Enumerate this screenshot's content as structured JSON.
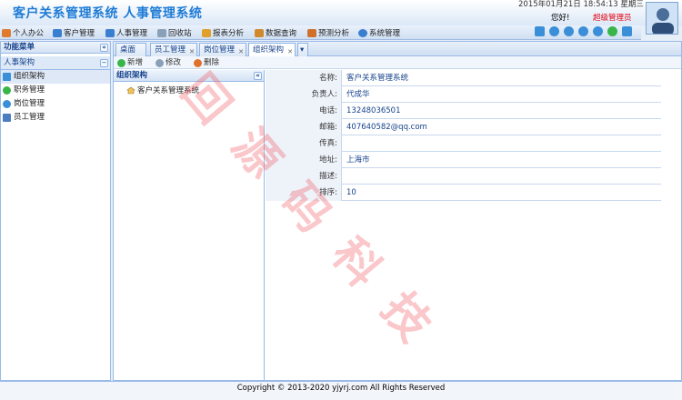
{
  "header": {
    "title": "客户关系管理系统 人事管理系统",
    "datetime": "2015年01月21日 18:54:13 星期三",
    "greeting": "您好!",
    "user": "超级管理员"
  },
  "menu": [
    {
      "label": "个人办公",
      "icon": "home-icon",
      "color": "#e07a2c"
    },
    {
      "label": "客户管理",
      "icon": "link-icon",
      "color": "#3a7ed0"
    },
    {
      "label": "人事管理",
      "icon": "users-icon",
      "color": "#3a7ed0"
    },
    {
      "label": "回收站",
      "icon": "trash-icon",
      "color": "#8aa0b8"
    },
    {
      "label": "报表分析",
      "icon": "report-icon",
      "color": "#e0a02c"
    },
    {
      "label": "数据查询",
      "icon": "search-data-icon",
      "color": "#d08a2c"
    },
    {
      "label": "预测分析",
      "icon": "chart-icon",
      "color": "#d0702c"
    },
    {
      "label": "系统管理",
      "icon": "gear-icon",
      "color": "#3a7ed0"
    }
  ],
  "sidebar": {
    "title": "功能菜单",
    "section": "人事架构",
    "items": [
      {
        "label": "组织架构",
        "icon": "org-icon"
      },
      {
        "label": "职务管理",
        "icon": "job-icon"
      },
      {
        "label": "岗位管理",
        "icon": "post-icon"
      },
      {
        "label": "员工管理",
        "icon": "staff-icon"
      }
    ]
  },
  "tabs": [
    {
      "label": "桌面"
    },
    {
      "label": "员工管理"
    },
    {
      "label": "岗位管理"
    },
    {
      "label": "组织架构"
    }
  ],
  "toolbar": {
    "add": "新增",
    "edit": "修改",
    "delete": "删除"
  },
  "org_panel": {
    "title": "组织架构",
    "root": "客户关系管理系统"
  },
  "details": [
    {
      "label": "名称:",
      "value": "客户关系管理系统"
    },
    {
      "label": "负责人:",
      "value": "代成华"
    },
    {
      "label": "电话:",
      "value": "13248036501"
    },
    {
      "label": "邮箱:",
      "value": "407640582@qq.com"
    },
    {
      "label": "传真:",
      "value": ""
    },
    {
      "label": "地址:",
      "value": "上海市"
    },
    {
      "label": "描述:",
      "value": ""
    },
    {
      "label": "排序:",
      "value": "10"
    }
  ],
  "footer": "Copyright © 2013-2020 yjyrj.com All Rights Reserved",
  "watermark": [
    "回",
    "源",
    "码",
    "科",
    "技"
  ],
  "colors": {
    "accent": "#1e7bd6",
    "role": "#e60012",
    "border": "#99bbe8"
  }
}
